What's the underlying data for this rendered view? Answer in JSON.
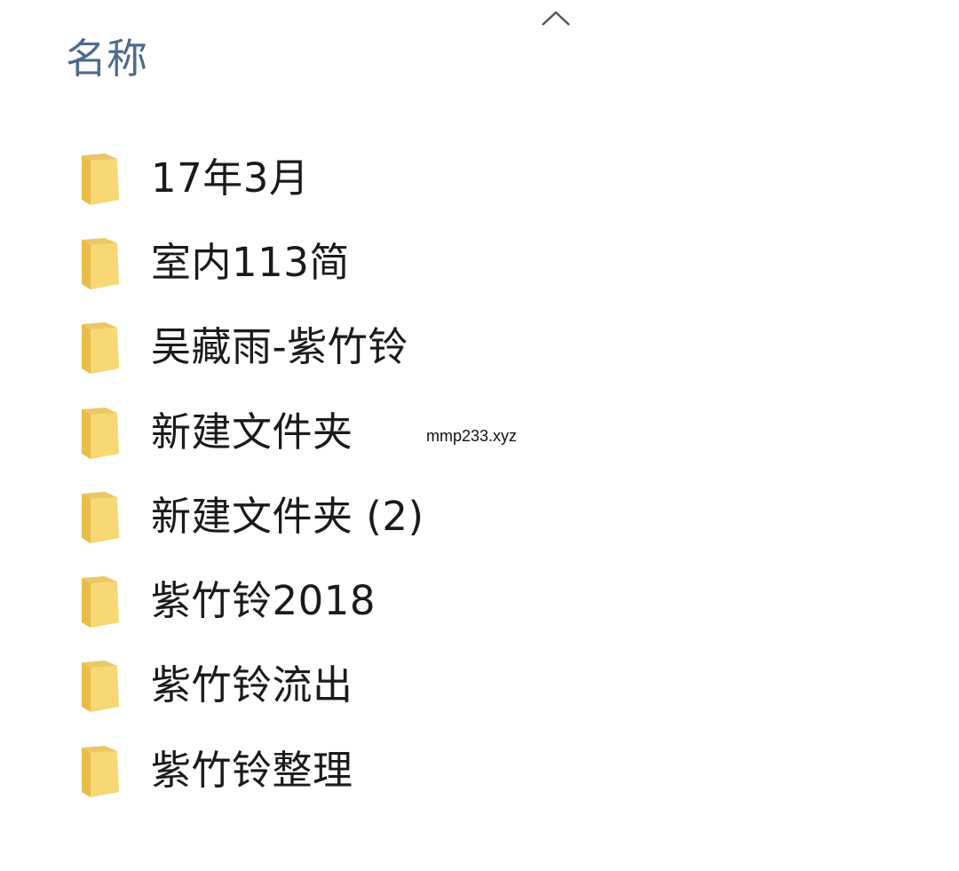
{
  "header": {
    "column_name_label": "名称",
    "sort_indicator_icon": "chevron-up-icon"
  },
  "colors": {
    "header_text": "#4f6b8a",
    "item_text": "#1b1b1b",
    "folder_yellow": "#f8d775",
    "folder_shade": "#e8bd4a"
  },
  "items": [
    {
      "name": "17年3月",
      "icon": "folder-icon"
    },
    {
      "name": "室内113简",
      "icon": "folder-icon"
    },
    {
      "name": "吴藏雨-紫竹铃",
      "icon": "folder-icon"
    },
    {
      "name": "新建文件夹",
      "icon": "folder-icon"
    },
    {
      "name": "新建文件夹 (2)",
      "icon": "folder-icon"
    },
    {
      "name": "紫竹铃2018",
      "icon": "folder-icon"
    },
    {
      "name": "紫竹铃流出",
      "icon": "folder-icon"
    },
    {
      "name": "紫竹铃整理",
      "icon": "folder-icon"
    }
  ],
  "watermark": "mmp233.xyz"
}
